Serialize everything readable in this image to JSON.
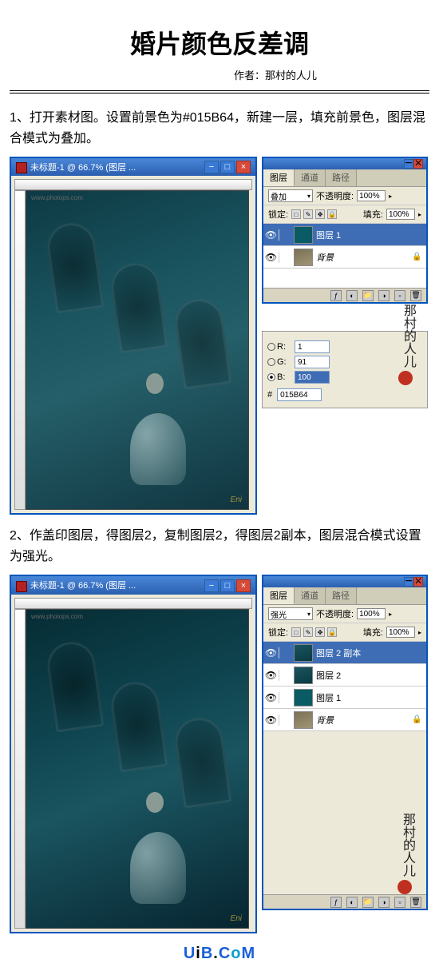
{
  "title": "婚片颜色反差调",
  "author_prefix": "作者：",
  "author_name": "那村的人儿",
  "steps": {
    "step1": "1、打开素材图。设置前景色为#015B64，新建一层，填充前景色，图层混合模式为叠加。",
    "step2": "2、作盖印图层，得图层2，复制图层2，得图层2副本，图层混合模式设置为强光。"
  },
  "ps": {
    "doc_title": "未标题-1 @ 66.7% (图层 ...",
    "wm_top": "www.photops.com",
    "wm_bottom": "Eni"
  },
  "panel": {
    "tabs": {
      "layers": "图层",
      "channels": "通道",
      "paths": "路径"
    },
    "blend_overlay": "叠加",
    "blend_hardlight": "强光",
    "opacity_label": "不透明度:",
    "opacity_value": "100%",
    "lock_label": "锁定:",
    "fill_label": "填充:",
    "fill_value": "100%"
  },
  "layers1": {
    "l1": "图层 1",
    "bg": "背景"
  },
  "layers2": {
    "l2copy": "图层 2 副本",
    "l2": "图层 2",
    "l1": "图层 1",
    "bg": "背景"
  },
  "color_picker": {
    "r_label": "R:",
    "r_value": "1",
    "g_label": "G:",
    "g_value": "91",
    "b_label": "B:",
    "b_value": "100",
    "hex_label": "#",
    "hex_value": "015B64"
  },
  "signature": "那村的人儿",
  "footer": {
    "u": "U",
    "i": "i",
    "b": "B",
    "dot": ".",
    "c": "C",
    "o": "o",
    "m": "M"
  }
}
